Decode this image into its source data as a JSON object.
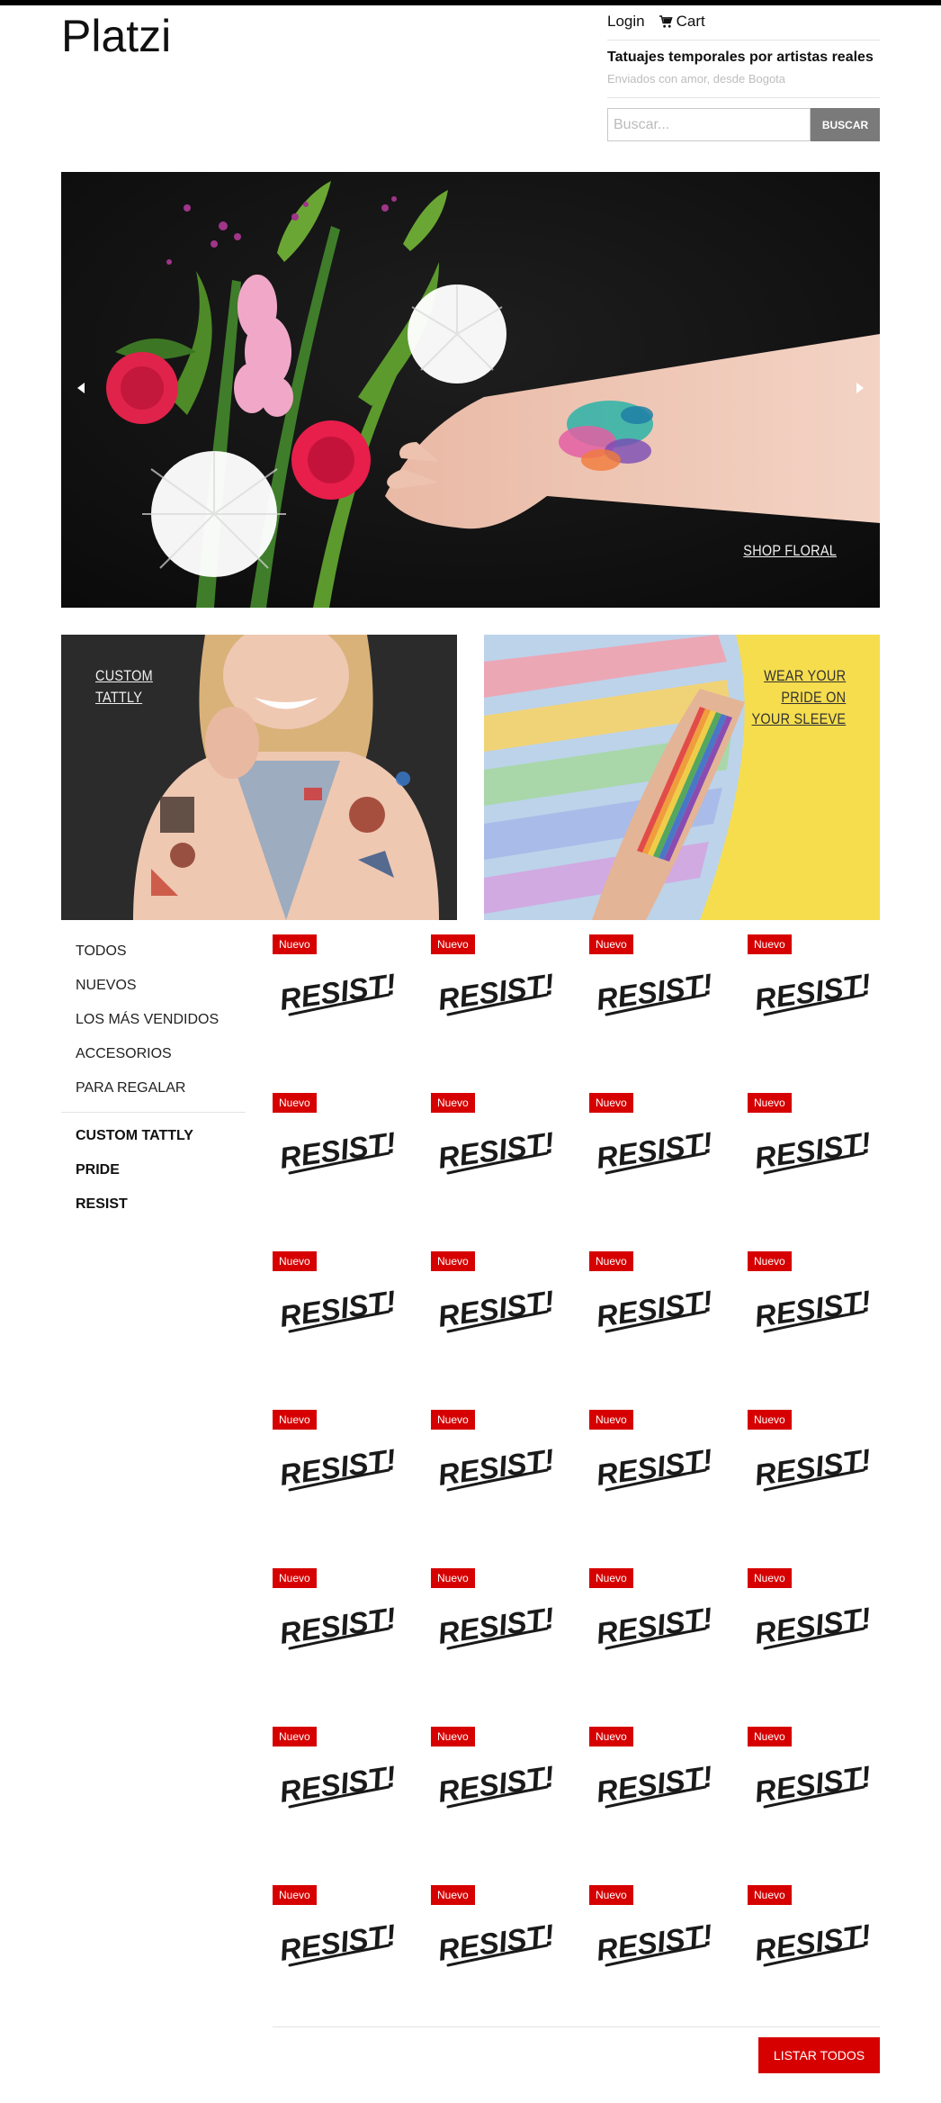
{
  "header": {
    "logo": "Platzi",
    "login_label": "Login",
    "cart_label": "Cart",
    "tagline": "Tatuajes temporales por artistas reales",
    "subtagline": "Enviados con amor, desde Bogota",
    "search_placeholder": "Buscar...",
    "search_button": "BUSCAR"
  },
  "hero": {
    "link_label": "SHOP FLORAL"
  },
  "promos": [
    {
      "label_line1": "CUSTOM",
      "label_line2": "TATTLY"
    },
    {
      "label_line1": "WEAR YOUR",
      "label_line2": "PRIDE ON",
      "label_line3": "YOUR SLEEVE"
    }
  ],
  "sidebar": {
    "categories": [
      "TODOS",
      "NUEVOS",
      "LOS MÁS VENDIDOS",
      "ACCESORIOS",
      "PARA REGALAR"
    ],
    "collections": [
      "CUSTOM TATTLY",
      "PRIDE",
      "RESIST"
    ]
  },
  "products": {
    "badge_label": "Nuevo",
    "product_image_text": "RESIST!",
    "list_all_label": "LISTAR TODOS"
  },
  "colors": {
    "accent_red": "#d60000",
    "search_button_gray": "#7a7a7a",
    "promo_yellow": "#f6dd4e"
  }
}
